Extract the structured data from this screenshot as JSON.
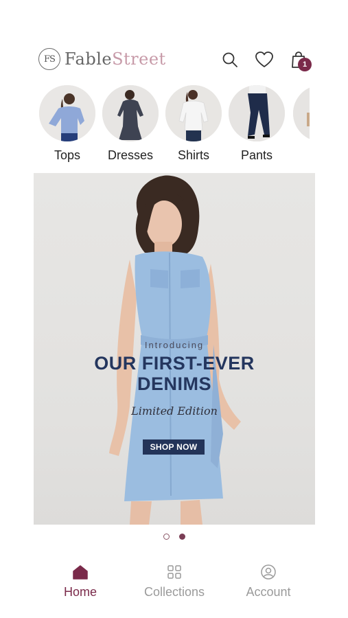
{
  "brand": {
    "mark": "FS",
    "name_part1": "Fable",
    "name_part2": "Street"
  },
  "header": {
    "icons": [
      "search-icon",
      "heart-icon",
      "shopping-bag-icon"
    ],
    "cart_count": "1"
  },
  "categories": [
    {
      "label": "Tops"
    },
    {
      "label": "Dresses"
    },
    {
      "label": "Shirts"
    },
    {
      "label": "Pants"
    }
  ],
  "banner": {
    "intro": "Introducing",
    "headline_line1": "OUR FIRST-EVER",
    "headline_line2": "DENIMS",
    "subtitle": "Limited Edition",
    "cta": "SHOP NOW"
  },
  "carousel": {
    "total": 2,
    "active_index": 1
  },
  "bottom_nav": [
    {
      "label": "Home",
      "icon": "home-icon",
      "active": true
    },
    {
      "label": "Collections",
      "icon": "grid-icon",
      "active": false
    },
    {
      "label": "Account",
      "icon": "user-icon",
      "active": false
    }
  ],
  "colors": {
    "accent": "#7a2a4a",
    "navy": "#24365e",
    "inactive": "#9a9a9a"
  }
}
